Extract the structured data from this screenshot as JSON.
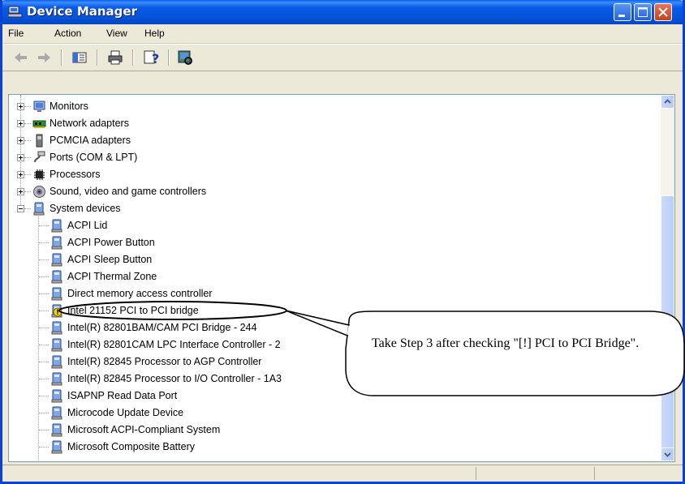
{
  "window": {
    "title": "Device Manager",
    "title_color": "#0A5AE8"
  },
  "menu": {
    "file": "File",
    "action": "Action",
    "view": "View",
    "help": "Help"
  },
  "toolbar": {
    "icons": [
      "back-arrow-icon",
      "forward-arrow-icon",
      "properties-icon",
      "print-icon",
      "help-icon",
      "scan-hardware-icon"
    ]
  },
  "tree": {
    "categories": [
      {
        "label": "Monitors",
        "icon": "monitor-icon"
      },
      {
        "label": "Network adapters",
        "icon": "network-card-icon"
      },
      {
        "label": "PCMCIA adapters",
        "icon": "pcmcia-icon"
      },
      {
        "label": "Ports (COM & LPT)",
        "icon": "port-icon"
      },
      {
        "label": "Processors",
        "icon": "processor-icon"
      },
      {
        "label": "Sound, video and game controllers",
        "icon": "sound-icon"
      },
      {
        "label": "System devices",
        "icon": "system-device-icon"
      }
    ],
    "system_devices": [
      {
        "label": "ACPI Lid",
        "warning": false
      },
      {
        "label": "ACPI Power Button",
        "warning": false
      },
      {
        "label": "ACPI Sleep Button",
        "warning": false
      },
      {
        "label": "ACPI Thermal Zone",
        "warning": false
      },
      {
        "label": "Direct memory access controller",
        "warning": false
      },
      {
        "label": "Intel 21152 PCI to PCI bridge",
        "warning": true
      },
      {
        "label": "Intel(R) 82801BAM/CAM PCI Bridge - 244",
        "warning": false
      },
      {
        "label": "Intel(R) 82801CAM LPC Interface Controller - 2",
        "warning": false
      },
      {
        "label": "Intel(R) 82845 Processor to AGP Controller",
        "warning": false
      },
      {
        "label": "Intel(R) 82845 Processor to I/O Controller - 1A3",
        "warning": false
      },
      {
        "label": "ISAPNP Read Data Port",
        "warning": false
      },
      {
        "label": "Microcode Update Device",
        "warning": false
      },
      {
        "label": "Microsoft ACPI-Compliant System",
        "warning": false
      },
      {
        "label": "Microsoft Composite Battery",
        "warning": false
      }
    ]
  },
  "callout": {
    "text": "Take Step 3 after checking \"[!] PCI to PCI Bridge\"."
  },
  "colors": {
    "window_bg": "#ECE9D8",
    "warning": "#F5D400",
    "scrollbar": "#C8D7F8"
  }
}
